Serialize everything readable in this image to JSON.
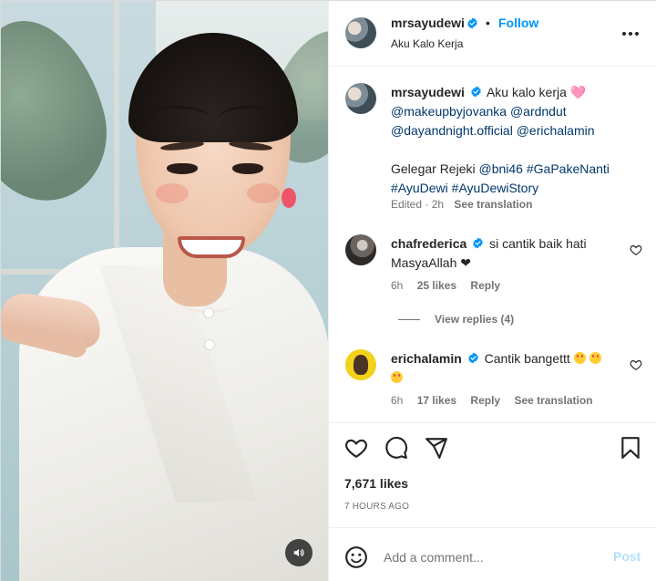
{
  "post": {
    "author": "mrsayudewi",
    "follow_label": "Follow",
    "separator": "•",
    "audio_title": "Aku Kalo Kerja",
    "more_options_icon": "more-horizontal-icon",
    "verified_icon": "verified-badge-icon"
  },
  "caption": {
    "author": "mrsayudewi",
    "line1_text": "Aku kalo kerja 🩷",
    "mention1": "@makeupbyjovanka",
    "mention2": "@ardndut",
    "mention3": "@dayandnight.official",
    "mention4": "@erichalamin",
    "line5_text": "Gelegar Rejeki",
    "mention5": "@bni46",
    "hashtag1": "#GaPakeNanti",
    "hashtag2": "#AyuDewi",
    "hashtag3": "#AyuDewiStory",
    "meta_edited": "Edited · 2h",
    "see_translation": "See translation"
  },
  "comments": [
    {
      "author": "chafrederica",
      "text": "si cantik baik hati",
      "text_line2": "MasyaAllah ❤",
      "time": "6h",
      "likes": "25 likes",
      "reply": "Reply",
      "view_replies": "View replies (4)"
    },
    {
      "author": "erichalamin",
      "text": "Cantik bangettt",
      "time": "6h",
      "likes": "17 likes",
      "reply": "Reply",
      "see_translation": "See translation"
    }
  ],
  "actions": {
    "like_icon": "heart-icon",
    "comment_icon": "comment-icon",
    "share_icon": "share-icon",
    "save_icon": "bookmark-icon",
    "likes_count": "7,671 likes",
    "time_ago": "7 HOURS AGO"
  },
  "composer": {
    "emoji_icon": "emoji-icon",
    "placeholder": "Add a comment...",
    "post_label": "Post"
  },
  "media": {
    "audio_icon": "speaker-icon"
  },
  "colors": {
    "link": "#00376b",
    "follow": "#0095f6",
    "verified": "#0095f6",
    "muted": "#737373",
    "like_heart": "#ed4956"
  }
}
